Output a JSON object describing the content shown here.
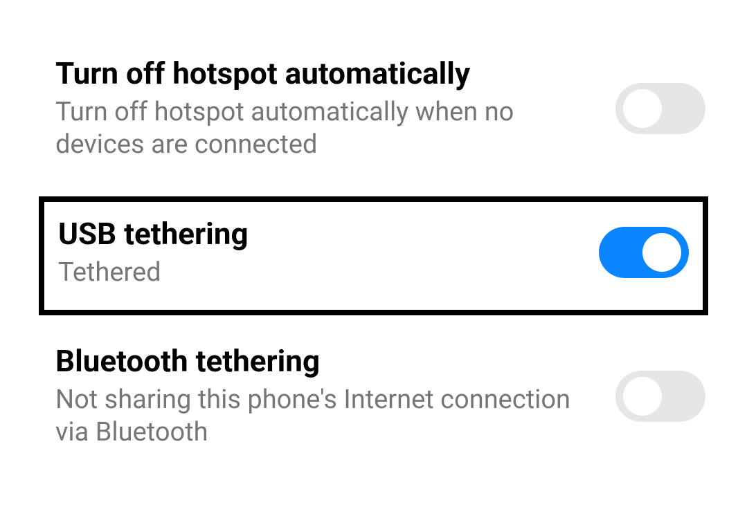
{
  "settings": [
    {
      "title": "Turn off hotspot automatically",
      "subtitle": "Turn off hotspot automatically when no devices are connected",
      "enabled": false,
      "highlighted": false
    },
    {
      "title": "USB tethering",
      "subtitle": "Tethered",
      "enabled": true,
      "highlighted": true
    },
    {
      "title": "Bluetooth tethering",
      "subtitle": "Not sharing this phone's Internet connection via Bluetooth",
      "enabled": false,
      "highlighted": false
    }
  ]
}
